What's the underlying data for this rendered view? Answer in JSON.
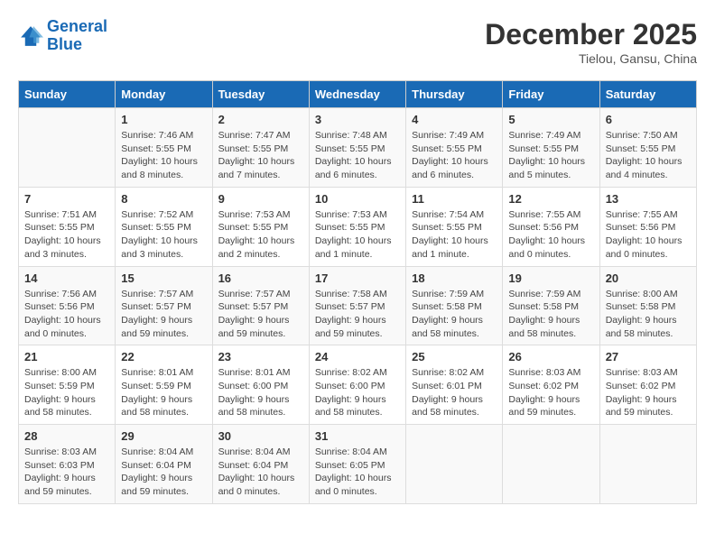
{
  "header": {
    "logo_line1": "General",
    "logo_line2": "Blue",
    "month": "December 2025",
    "location": "Tielou, Gansu, China"
  },
  "weekdays": [
    "Sunday",
    "Monday",
    "Tuesday",
    "Wednesday",
    "Thursday",
    "Friday",
    "Saturday"
  ],
  "weeks": [
    [
      {
        "day": "",
        "info": ""
      },
      {
        "day": "1",
        "info": "Sunrise: 7:46 AM\nSunset: 5:55 PM\nDaylight: 10 hours\nand 8 minutes."
      },
      {
        "day": "2",
        "info": "Sunrise: 7:47 AM\nSunset: 5:55 PM\nDaylight: 10 hours\nand 7 minutes."
      },
      {
        "day": "3",
        "info": "Sunrise: 7:48 AM\nSunset: 5:55 PM\nDaylight: 10 hours\nand 6 minutes."
      },
      {
        "day": "4",
        "info": "Sunrise: 7:49 AM\nSunset: 5:55 PM\nDaylight: 10 hours\nand 6 minutes."
      },
      {
        "day": "5",
        "info": "Sunrise: 7:49 AM\nSunset: 5:55 PM\nDaylight: 10 hours\nand 5 minutes."
      },
      {
        "day": "6",
        "info": "Sunrise: 7:50 AM\nSunset: 5:55 PM\nDaylight: 10 hours\nand 4 minutes."
      }
    ],
    [
      {
        "day": "7",
        "info": "Sunrise: 7:51 AM\nSunset: 5:55 PM\nDaylight: 10 hours\nand 3 minutes."
      },
      {
        "day": "8",
        "info": "Sunrise: 7:52 AM\nSunset: 5:55 PM\nDaylight: 10 hours\nand 3 minutes."
      },
      {
        "day": "9",
        "info": "Sunrise: 7:53 AM\nSunset: 5:55 PM\nDaylight: 10 hours\nand 2 minutes."
      },
      {
        "day": "10",
        "info": "Sunrise: 7:53 AM\nSunset: 5:55 PM\nDaylight: 10 hours\nand 1 minute."
      },
      {
        "day": "11",
        "info": "Sunrise: 7:54 AM\nSunset: 5:55 PM\nDaylight: 10 hours\nand 1 minute."
      },
      {
        "day": "12",
        "info": "Sunrise: 7:55 AM\nSunset: 5:56 PM\nDaylight: 10 hours\nand 0 minutes."
      },
      {
        "day": "13",
        "info": "Sunrise: 7:55 AM\nSunset: 5:56 PM\nDaylight: 10 hours\nand 0 minutes."
      }
    ],
    [
      {
        "day": "14",
        "info": "Sunrise: 7:56 AM\nSunset: 5:56 PM\nDaylight: 10 hours\nand 0 minutes."
      },
      {
        "day": "15",
        "info": "Sunrise: 7:57 AM\nSunset: 5:57 PM\nDaylight: 9 hours\nand 59 minutes."
      },
      {
        "day": "16",
        "info": "Sunrise: 7:57 AM\nSunset: 5:57 PM\nDaylight: 9 hours\nand 59 minutes."
      },
      {
        "day": "17",
        "info": "Sunrise: 7:58 AM\nSunset: 5:57 PM\nDaylight: 9 hours\nand 59 minutes."
      },
      {
        "day": "18",
        "info": "Sunrise: 7:59 AM\nSunset: 5:58 PM\nDaylight: 9 hours\nand 58 minutes."
      },
      {
        "day": "19",
        "info": "Sunrise: 7:59 AM\nSunset: 5:58 PM\nDaylight: 9 hours\nand 58 minutes."
      },
      {
        "day": "20",
        "info": "Sunrise: 8:00 AM\nSunset: 5:58 PM\nDaylight: 9 hours\nand 58 minutes."
      }
    ],
    [
      {
        "day": "21",
        "info": "Sunrise: 8:00 AM\nSunset: 5:59 PM\nDaylight: 9 hours\nand 58 minutes."
      },
      {
        "day": "22",
        "info": "Sunrise: 8:01 AM\nSunset: 5:59 PM\nDaylight: 9 hours\nand 58 minutes."
      },
      {
        "day": "23",
        "info": "Sunrise: 8:01 AM\nSunset: 6:00 PM\nDaylight: 9 hours\nand 58 minutes."
      },
      {
        "day": "24",
        "info": "Sunrise: 8:02 AM\nSunset: 6:00 PM\nDaylight: 9 hours\nand 58 minutes."
      },
      {
        "day": "25",
        "info": "Sunrise: 8:02 AM\nSunset: 6:01 PM\nDaylight: 9 hours\nand 58 minutes."
      },
      {
        "day": "26",
        "info": "Sunrise: 8:03 AM\nSunset: 6:02 PM\nDaylight: 9 hours\nand 59 minutes."
      },
      {
        "day": "27",
        "info": "Sunrise: 8:03 AM\nSunset: 6:02 PM\nDaylight: 9 hours\nand 59 minutes."
      }
    ],
    [
      {
        "day": "28",
        "info": "Sunrise: 8:03 AM\nSunset: 6:03 PM\nDaylight: 9 hours\nand 59 minutes."
      },
      {
        "day": "29",
        "info": "Sunrise: 8:04 AM\nSunset: 6:04 PM\nDaylight: 9 hours\nand 59 minutes."
      },
      {
        "day": "30",
        "info": "Sunrise: 8:04 AM\nSunset: 6:04 PM\nDaylight: 10 hours\nand 0 minutes."
      },
      {
        "day": "31",
        "info": "Sunrise: 8:04 AM\nSunset: 6:05 PM\nDaylight: 10 hours\nand 0 minutes."
      },
      {
        "day": "",
        "info": ""
      },
      {
        "day": "",
        "info": ""
      },
      {
        "day": "",
        "info": ""
      }
    ]
  ]
}
